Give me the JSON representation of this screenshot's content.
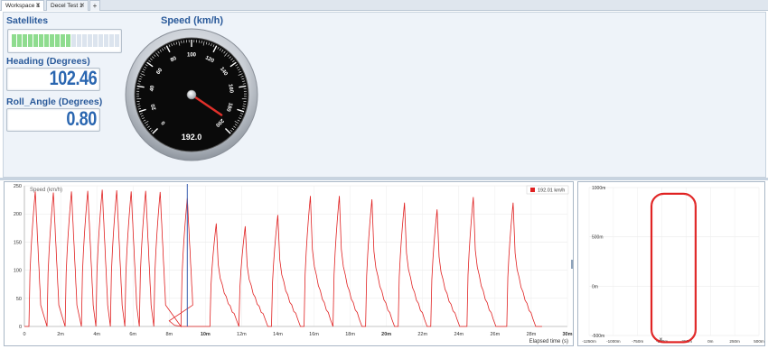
{
  "tabs": [
    {
      "label": "Workspace 1",
      "close": "✕"
    },
    {
      "label": "Decel Test 1",
      "close": "✕"
    },
    {
      "label": "+"
    }
  ],
  "satellites": {
    "label": "Satellites",
    "segments_total": 20,
    "segments_active": 11,
    "active_color": "#8fdc8f",
    "inactive_color": "#dce4ee"
  },
  "heading": {
    "label": "Heading (Degrees)",
    "value": "102.46"
  },
  "roll": {
    "label": "Roll_Angle (Degrees)",
    "value": "0.80"
  },
  "speedometer": {
    "title": "Speed (km/h)",
    "readout": "192.0",
    "value": 192.0,
    "min": 0,
    "max": 200,
    "tick_labels": [
      "0",
      "20",
      "40",
      "60",
      "80",
      "100",
      "120",
      "140",
      "160",
      "180",
      "200"
    ]
  },
  "chart_data": [
    {
      "type": "line",
      "title": "Speed (km/h)",
      "xlabel": "Elapsed time (s)",
      "ylabel": "",
      "ylim": [
        0,
        250
      ],
      "xlim": [
        0,
        30
      ],
      "y_ticks": [
        "0",
        "50",
        "100",
        "150",
        "200",
        "250"
      ],
      "x_ticks": [
        "0",
        "2m",
        "4m",
        "6m",
        "8m",
        "10m",
        "12m",
        "14m",
        "16m",
        "18m",
        "20m",
        "22m",
        "24m",
        "26m",
        "28m",
        "30m"
      ],
      "legend": "192.01 km/h",
      "series_color": "#e02020",
      "cursor_x": 9.0,
      "series": [
        {
          "name": "192.01 km/h",
          "peaks_full": [
            [
              0.6,
              240
            ],
            [
              1.6,
              238
            ],
            [
              2.6,
              240
            ],
            [
              3.5,
              241
            ],
            [
              4.3,
              243
            ],
            [
              5.1,
              242
            ],
            [
              5.9,
              240
            ],
            [
              6.7,
              241
            ],
            [
              7.5,
              239
            ],
            [
              9.0,
              228
            ]
          ],
          "peaks_decel": [
            [
              10.6,
              183
            ],
            [
              12.2,
              178
            ],
            [
              14.0,
              198
            ],
            [
              15.8,
              232
            ],
            [
              17.4,
              232
            ],
            [
              19.2,
              226
            ],
            [
              21.0,
              220
            ],
            [
              22.8,
              208
            ],
            [
              24.8,
              230
            ],
            [
              27.0,
              220
            ]
          ]
        }
      ],
      "grid": true
    },
    {
      "type": "scatter",
      "title": "",
      "x_ticks": [
        "-1250m",
        "-1000m",
        "-750m",
        "-500m",
        "-250m",
        "0m",
        "250m",
        "500m"
      ],
      "y_ticks": [
        "1000m",
        "500m",
        "0m",
        "-500m"
      ],
      "xlim": [
        -1250,
        500
      ],
      "ylim": [
        -500,
        1000
      ],
      "track": "rounded loop",
      "series_color": "#e02020",
      "grid": true
    }
  ]
}
